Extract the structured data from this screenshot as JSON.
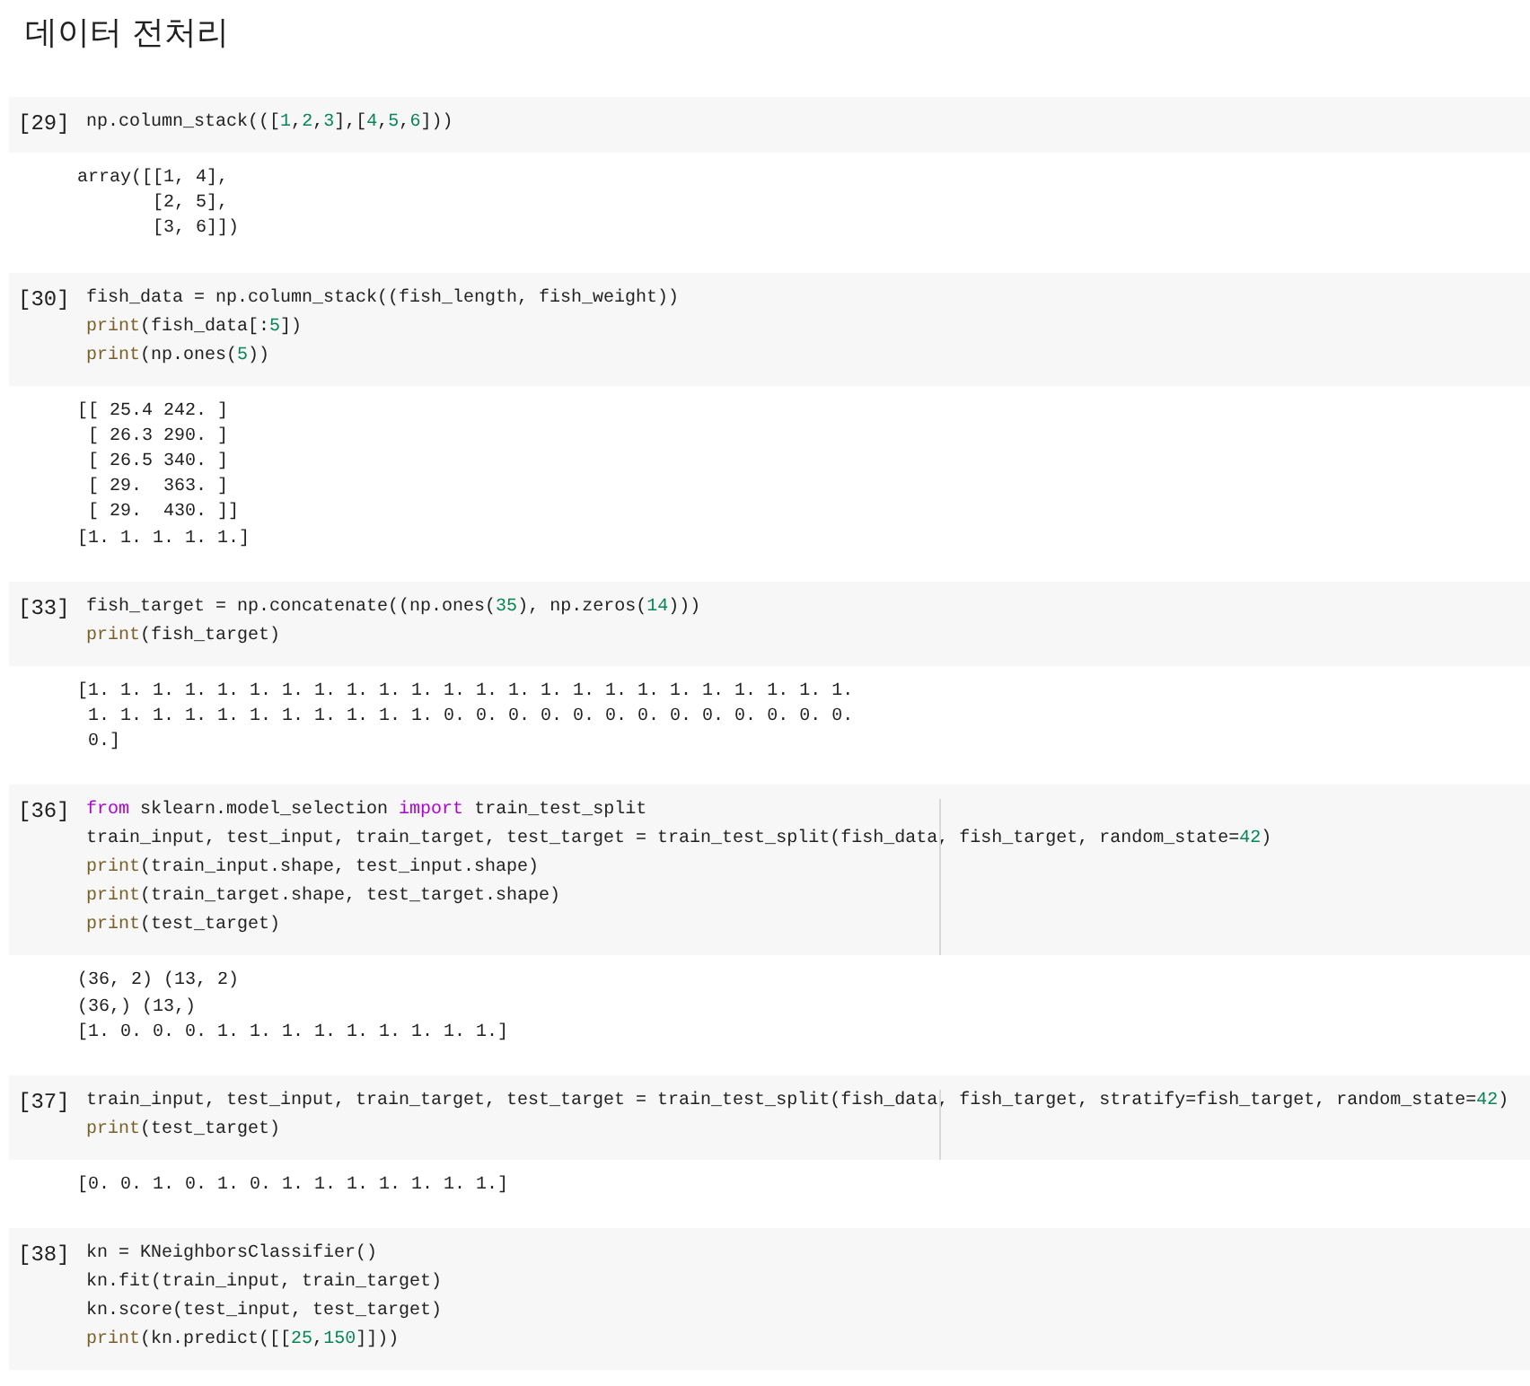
{
  "heading": "데이터 전처리",
  "cells": [
    {
      "count": "[29]",
      "ruler": false,
      "code": [
        [
          {
            "kind": "plain",
            "text": "np.column_stack((["
          },
          {
            "kind": "number",
            "text": "1"
          },
          {
            "kind": "plain",
            "text": ","
          },
          {
            "kind": "number",
            "text": "2"
          },
          {
            "kind": "plain",
            "text": ","
          },
          {
            "kind": "number",
            "text": "3"
          },
          {
            "kind": "plain",
            "text": "],["
          },
          {
            "kind": "number",
            "text": "4"
          },
          {
            "kind": "plain",
            "text": ","
          },
          {
            "kind": "number",
            "text": "5"
          },
          {
            "kind": "plain",
            "text": ","
          },
          {
            "kind": "number",
            "text": "6"
          },
          {
            "kind": "plain",
            "text": "]))"
          }
        ]
      ],
      "output": [
        "array([[1, 4],",
        "       [2, 5],",
        "       [3, 6]])"
      ]
    },
    {
      "count": "[30]",
      "ruler": false,
      "code": [
        [
          {
            "kind": "plain",
            "text": "fish_data = np.column_stack((fish_length, fish_weight))"
          }
        ],
        [
          {
            "kind": "builtin",
            "text": "print"
          },
          {
            "kind": "plain",
            "text": "(fish_data[:"
          },
          {
            "kind": "number",
            "text": "5"
          },
          {
            "kind": "plain",
            "text": "])"
          }
        ],
        [
          {
            "kind": "builtin",
            "text": "print"
          },
          {
            "kind": "plain",
            "text": "(np.ones("
          },
          {
            "kind": "number",
            "text": "5"
          },
          {
            "kind": "plain",
            "text": "))"
          }
        ]
      ],
      "output": [
        "[[ 25.4 242. ]",
        " [ 26.3 290. ]",
        " [ 26.5 340. ]",
        " [ 29.  363. ]",
        " [ 29.  430. ]]",
        "[1. 1. 1. 1. 1.]"
      ]
    },
    {
      "count": "[33]",
      "ruler": false,
      "code": [
        [
          {
            "kind": "plain",
            "text": "fish_target = np.concatenate((np.ones("
          },
          {
            "kind": "number",
            "text": "35"
          },
          {
            "kind": "plain",
            "text": "), np.zeros("
          },
          {
            "kind": "number",
            "text": "14"
          },
          {
            "kind": "plain",
            "text": ")))"
          }
        ],
        [
          {
            "kind": "builtin",
            "text": "print"
          },
          {
            "kind": "plain",
            "text": "(fish_target)"
          }
        ]
      ],
      "output": [
        "[1. 1. 1. 1. 1. 1. 1. 1. 1. 1. 1. 1. 1. 1. 1. 1. 1. 1. 1. 1. 1. 1. 1. 1.",
        " 1. 1. 1. 1. 1. 1. 1. 1. 1. 1. 1. 0. 0. 0. 0. 0. 0. 0. 0. 0. 0. 0. 0. 0.",
        " 0.]"
      ]
    },
    {
      "count": "[36]",
      "ruler": true,
      "code": [
        [
          {
            "kind": "keyword",
            "text": "from"
          },
          {
            "kind": "plain",
            "text": " sklearn.model_selection "
          },
          {
            "kind": "keyword",
            "text": "import"
          },
          {
            "kind": "plain",
            "text": " train_test_split"
          }
        ],
        [
          {
            "kind": "plain",
            "text": "train_input, test_input, train_target, test_target = train_test_split(fish_data, fish_target, random_state="
          },
          {
            "kind": "number",
            "text": "42"
          },
          {
            "kind": "plain",
            "text": ")"
          }
        ],
        [
          {
            "kind": "builtin",
            "text": "print"
          },
          {
            "kind": "plain",
            "text": "(train_input.shape, test_input.shape)"
          }
        ],
        [
          {
            "kind": "builtin",
            "text": "print"
          },
          {
            "kind": "plain",
            "text": "(train_target.shape, test_target.shape)"
          }
        ],
        [
          {
            "kind": "builtin",
            "text": "print"
          },
          {
            "kind": "plain",
            "text": "(test_target)"
          }
        ]
      ],
      "output": [
        "(36, 2) (13, 2)",
        "(36,) (13,)",
        "[1. 0. 0. 0. 1. 1. 1. 1. 1. 1. 1. 1. 1.]"
      ]
    },
    {
      "count": "[37]",
      "ruler": true,
      "code": [
        [
          {
            "kind": "plain",
            "text": "train_input, test_input, train_target, test_target = train_test_split(fish_data, fish_target, stratify=fish_target, random_state="
          },
          {
            "kind": "number",
            "text": "42"
          },
          {
            "kind": "plain",
            "text": ")"
          }
        ],
        [
          {
            "kind": "builtin",
            "text": "print"
          },
          {
            "kind": "plain",
            "text": "(test_target)"
          }
        ]
      ],
      "output": [
        "[0. 0. 1. 0. 1. 0. 1. 1. 1. 1. 1. 1. 1.]"
      ]
    },
    {
      "count": "[38]",
      "ruler": false,
      "code": [
        [
          {
            "kind": "plain",
            "text": "kn = KNeighborsClassifier()"
          }
        ],
        [
          {
            "kind": "plain",
            "text": "kn.fit(train_input, train_target)"
          }
        ],
        [
          {
            "kind": "plain",
            "text": "kn.score(test_input, test_target)"
          }
        ],
        [
          {
            "kind": "builtin",
            "text": "print"
          },
          {
            "kind": "plain",
            "text": "(kn.predict([["
          },
          {
            "kind": "number",
            "text": "25"
          },
          {
            "kind": "plain",
            "text": ","
          },
          {
            "kind": "number",
            "text": "150"
          },
          {
            "kind": "plain",
            "text": "]]))"
          }
        ]
      ]
    }
  ]
}
